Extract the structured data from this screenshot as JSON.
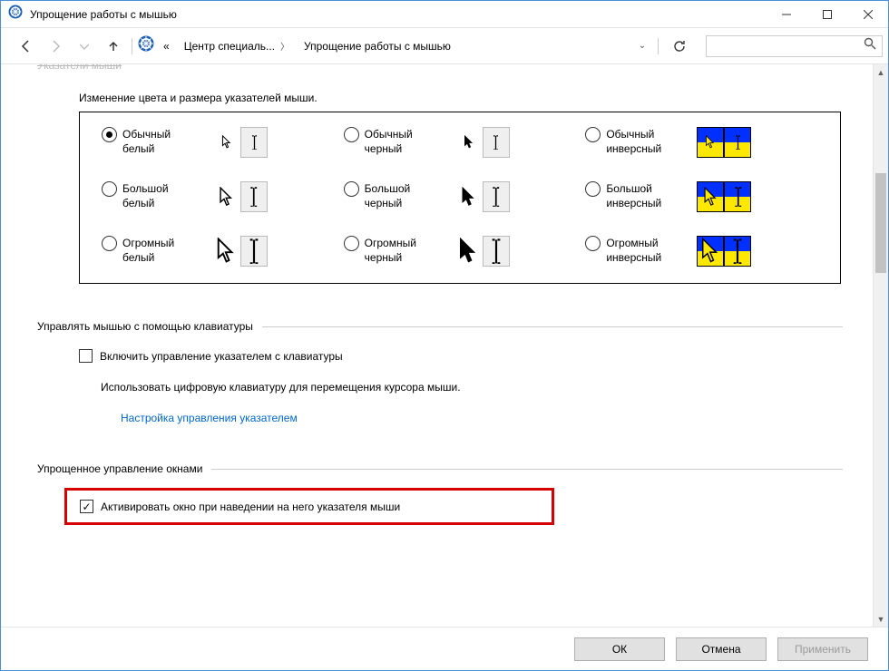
{
  "window": {
    "title": "Упрощение работы с мышью"
  },
  "nav": {
    "crumb_prefix": "«",
    "crumb1": "Центр специаль...",
    "crumb2": "Упрощение работы с мышью",
    "search_placeholder": ""
  },
  "content": {
    "cut_heading": "Указатели мыши",
    "pointer_desc": "Изменение цвета и размера указателей мыши.",
    "options": [
      {
        "label": "Обычный белый",
        "selected": true,
        "kind": "white",
        "size": "s"
      },
      {
        "label": "Обычный черный",
        "selected": false,
        "kind": "black",
        "size": "s"
      },
      {
        "label": "Обычный инверсный",
        "selected": false,
        "kind": "inv",
        "size": "s"
      },
      {
        "label": "Большой белый",
        "selected": false,
        "kind": "white",
        "size": "m"
      },
      {
        "label": "Большой черный",
        "selected": false,
        "kind": "black",
        "size": "m"
      },
      {
        "label": "Большой инверсный",
        "selected": false,
        "kind": "inv",
        "size": "m"
      },
      {
        "label": "Огромный белый",
        "selected": false,
        "kind": "white",
        "size": "l"
      },
      {
        "label": "Огромный черный",
        "selected": false,
        "kind": "black",
        "size": "l"
      },
      {
        "label": "Огромный инверсный",
        "selected": false,
        "kind": "inv",
        "size": "l"
      }
    ],
    "group_keyboard": {
      "title": "Управлять мышью с помощью клавиатуры",
      "check_label": "Включить управление указателем с клавиатуры",
      "desc": "Использовать цифровую клавиатуру для перемещения курсора мыши.",
      "link": "Настройка управления указателем"
    },
    "group_windows": {
      "title": "Упрощенное управление окнами",
      "check_label": "Активировать окно при наведении на него указателя мыши"
    }
  },
  "footer": {
    "ok": "ОК",
    "cancel": "Отмена",
    "apply": "Применить"
  }
}
